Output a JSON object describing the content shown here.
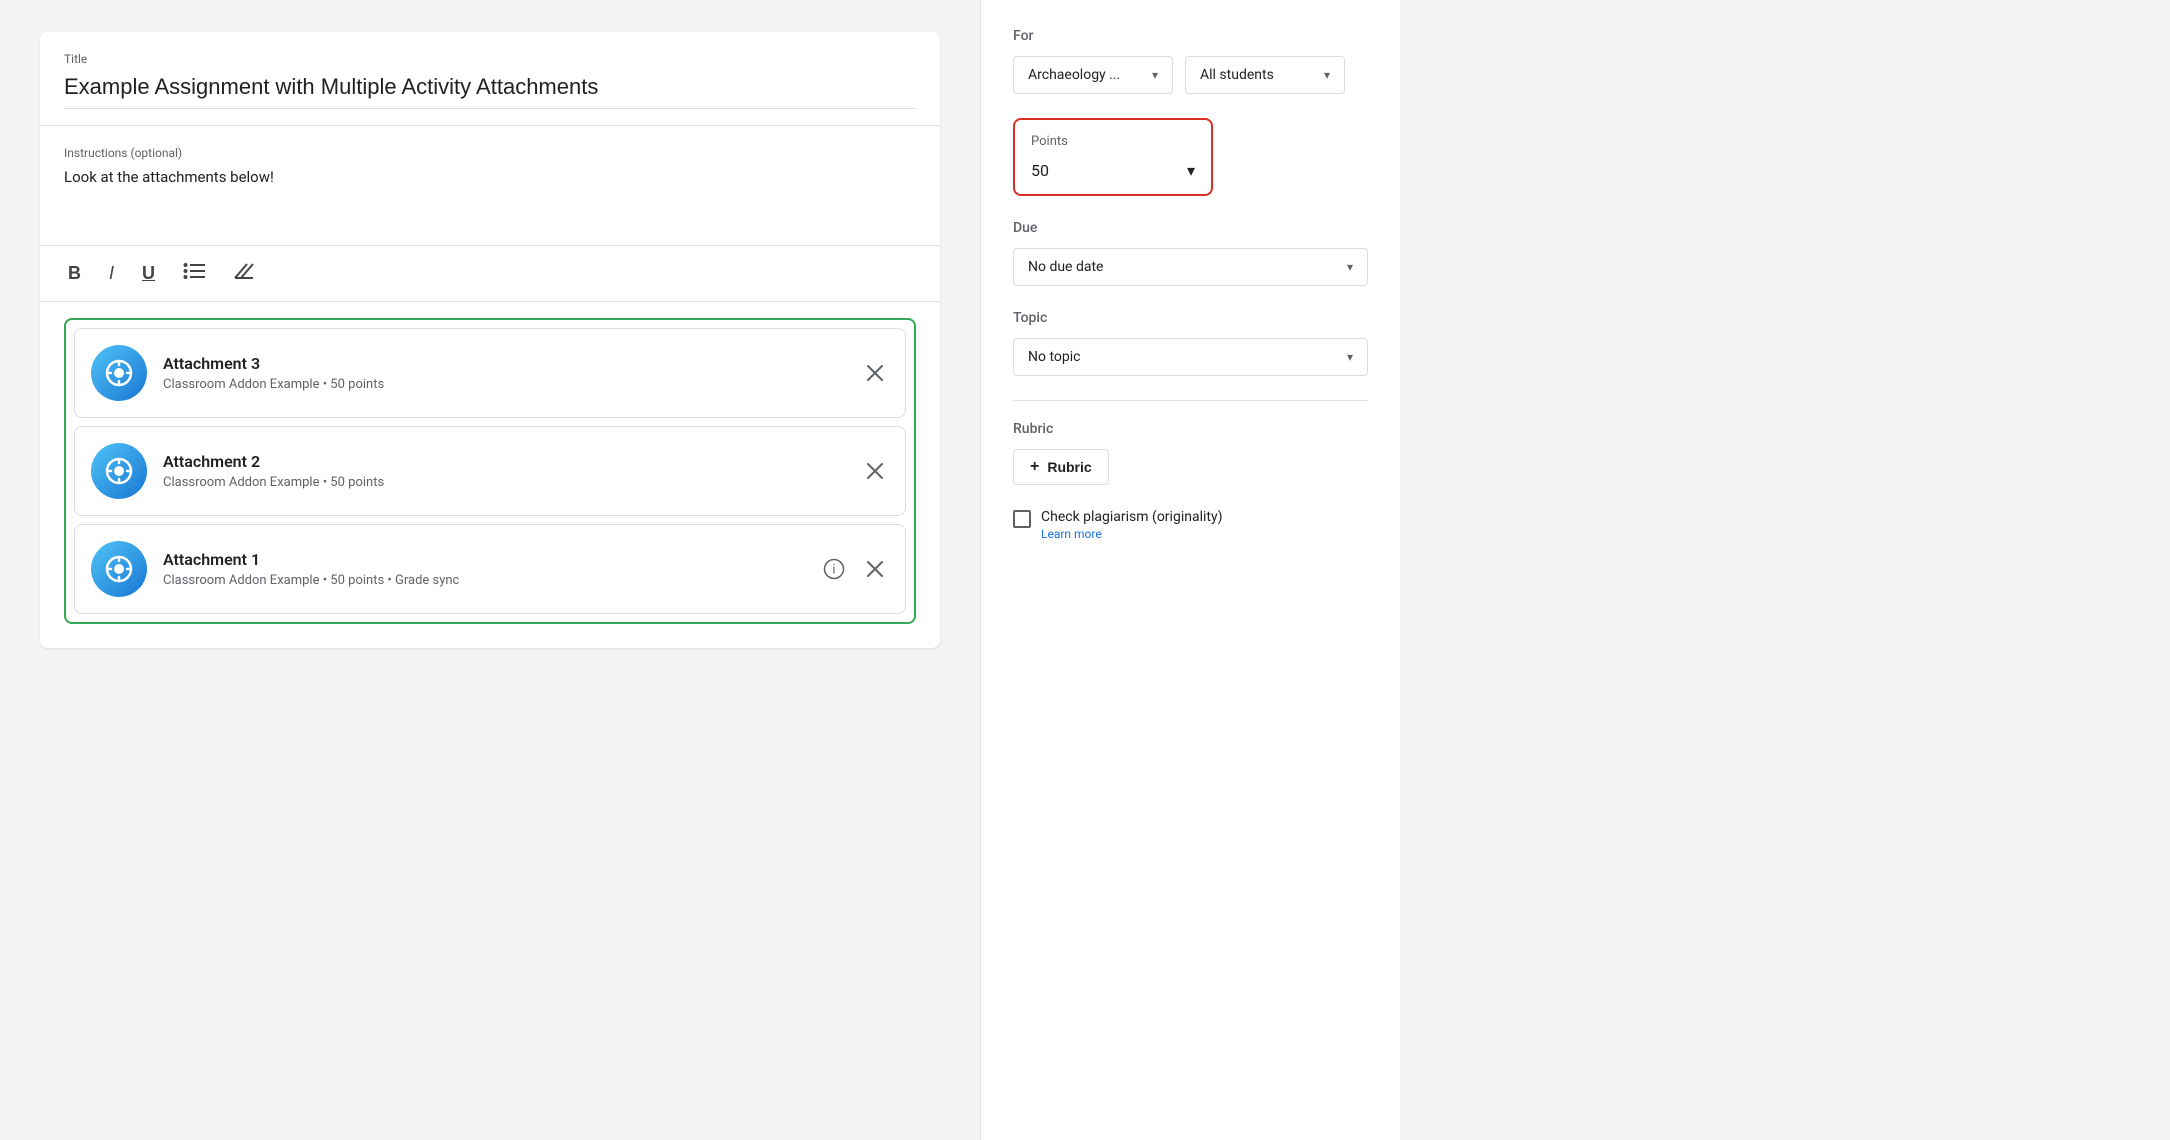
{
  "title_field": {
    "label": "Title",
    "value": "Example Assignment with Multiple Activity Attachments"
  },
  "instructions_field": {
    "label": "Instructions (optional)",
    "value": "Look at the attachments below!"
  },
  "toolbar": {
    "bold": "B",
    "italic": "I",
    "underline": "U",
    "list": "≡",
    "clear": "✗"
  },
  "attachments": [
    {
      "title": "Attachment 3",
      "subtitle": "Classroom Addon Example • 50 points",
      "has_info": false
    },
    {
      "title": "Attachment 2",
      "subtitle": "Classroom Addon Example • 50 points",
      "has_info": false
    },
    {
      "title": "Attachment 1",
      "subtitle": "Classroom Addon Example • 50 points • Grade sync",
      "has_info": true
    }
  ],
  "sidebar": {
    "for_label": "For",
    "course_dropdown": "Archaeology ...",
    "students_dropdown": "All students",
    "points_label": "Points",
    "points_value": "50",
    "due_label": "Due",
    "due_dropdown": "No due date",
    "topic_label": "Topic",
    "topic_dropdown": "No topic",
    "rubric_label": "Rubric",
    "rubric_btn": "Rubric",
    "plagiarism_label": "Check plagiarism (originality)",
    "learn_more": "Learn more"
  }
}
